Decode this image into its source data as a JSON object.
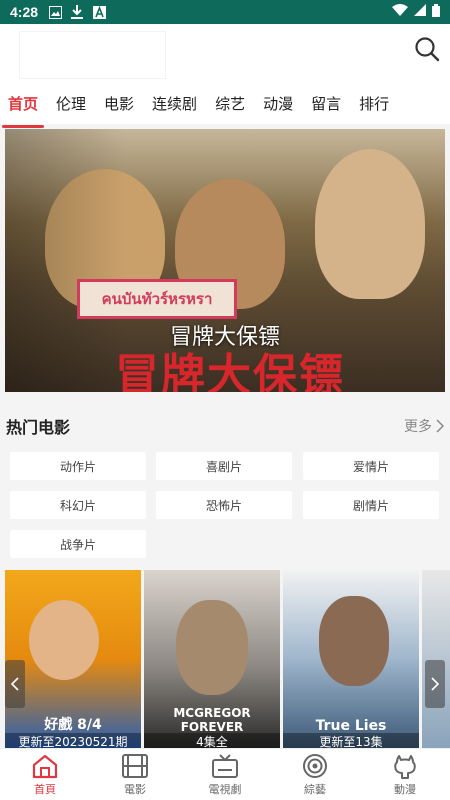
{
  "status_bar": {
    "time": "4:28"
  },
  "tabs": [
    {
      "label": "首页",
      "active": true
    },
    {
      "label": "伦理"
    },
    {
      "label": "电影"
    },
    {
      "label": "连续剧"
    },
    {
      "label": "综艺"
    },
    {
      "label": "动漫"
    },
    {
      "label": "留言"
    },
    {
      "label": "排行"
    }
  ],
  "banner": {
    "caption": "冒牌大保镖",
    "sign_text": "คนบันทัวร์หรหรา",
    "poster_text": "冒牌大保镖"
  },
  "section": {
    "title": "热门电影",
    "more_label": "更多"
  },
  "genres": [
    "动作片",
    "喜剧片",
    "爱情片",
    "科幻片",
    "恐怖片",
    "剧情片",
    "战争片"
  ],
  "posters": [
    {
      "title": "好戲 8/4",
      "status": "更新至20230521期"
    },
    {
      "title": "MCGREGOR FOREVER",
      "status": "4集全"
    },
    {
      "title": "True Lies",
      "status": "更新至13集"
    }
  ],
  "bottom_nav": [
    {
      "label": "首頁",
      "icon": "home-icon",
      "active": true
    },
    {
      "label": "電影",
      "icon": "film-icon"
    },
    {
      "label": "電視劇",
      "icon": "tv-icon"
    },
    {
      "label": "綜藝",
      "icon": "target-icon"
    },
    {
      "label": "動漫",
      "icon": "github-icon"
    }
  ],
  "colors": {
    "accent": "#e0383e",
    "status_bar": "#0e6b5c"
  }
}
